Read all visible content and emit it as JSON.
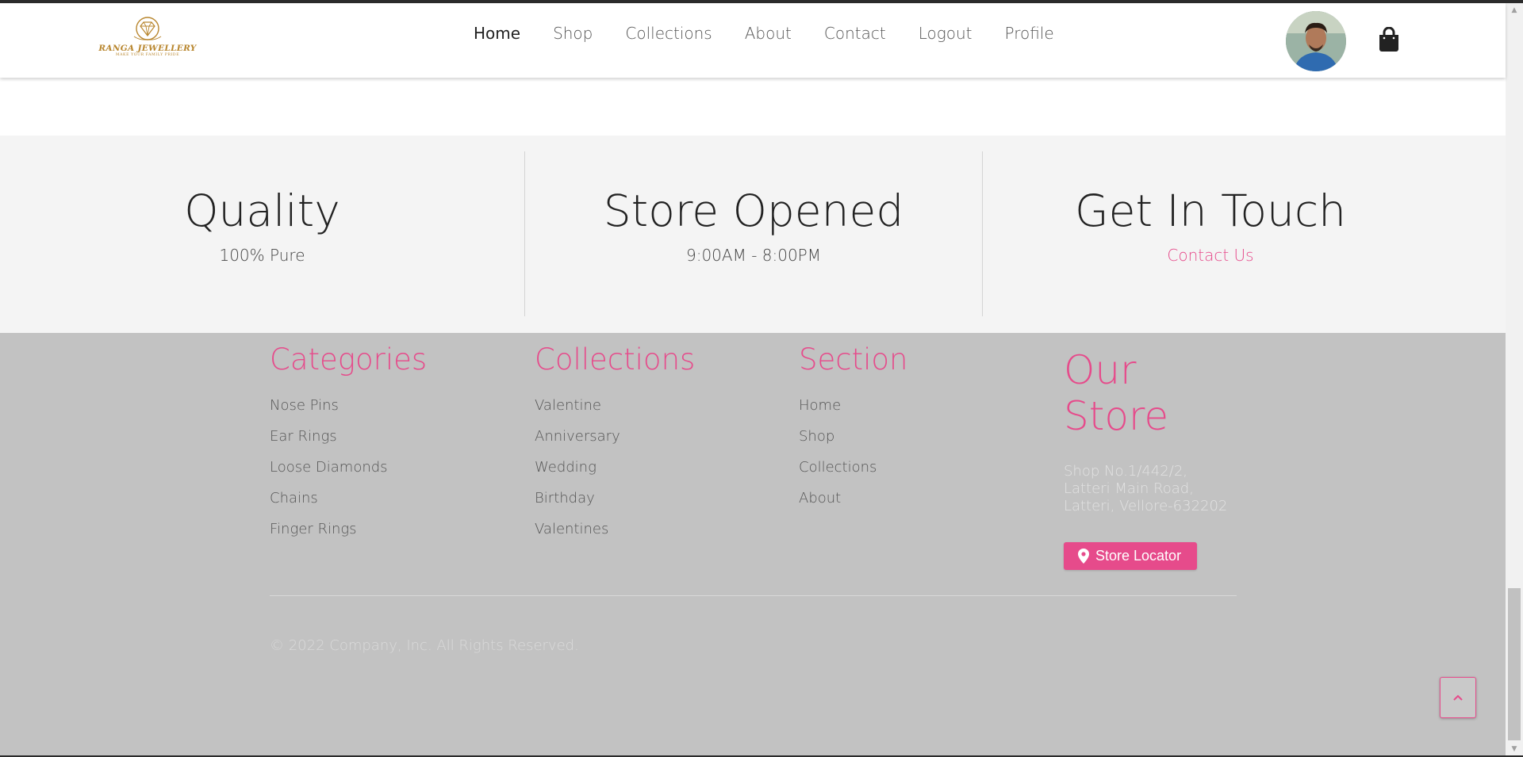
{
  "brand": {
    "name": "RANGA JEWELLERY",
    "tagline": "MAKE YOUR FAMILY PRIDE"
  },
  "nav": {
    "items": [
      {
        "label": "Home"
      },
      {
        "label": "Shop"
      },
      {
        "label": "Collections"
      },
      {
        "label": "About"
      },
      {
        "label": "Contact"
      },
      {
        "label": "Logout"
      },
      {
        "label": "Profile"
      }
    ],
    "active": "Home"
  },
  "features": [
    {
      "title": "Quality",
      "subtitle": "100% Pure"
    },
    {
      "title": "Store Opened",
      "subtitle": "9:00AM - 8:00PM"
    },
    {
      "title": "Get In Touch",
      "link": "Contact Us"
    }
  ],
  "footer": {
    "categories": {
      "title": "Categories",
      "items": [
        "Nose Pins",
        "Ear Rings",
        "Loose Diamonds",
        "Chains",
        "Finger Rings"
      ]
    },
    "collections": {
      "title": "Collections",
      "items": [
        "Valentine",
        "Anniversary",
        "Wedding",
        "Birthday",
        "Valentines"
      ]
    },
    "section": {
      "title": "Section",
      "items": [
        "Home",
        "Shop",
        "Collections",
        "About"
      ]
    },
    "store": {
      "title_line1": "Our",
      "title_line2": "Store",
      "address": [
        "Shop No.1/442/2,",
        "Latteri Main Road,",
        "Latteri, Vellore-632202"
      ],
      "locator_label": "Store Locator"
    },
    "copyright": "© 2022 Company, Inc. All Rights Reserved."
  },
  "colors": {
    "accent": "#e64b8b",
    "footer_bg": "#c2c2c2",
    "feature_bg": "#f4f4f4"
  },
  "icons": {
    "cart": "shopping-bag-icon",
    "locator": "map-marker-icon",
    "back_to_top": "chevron-up-icon"
  }
}
